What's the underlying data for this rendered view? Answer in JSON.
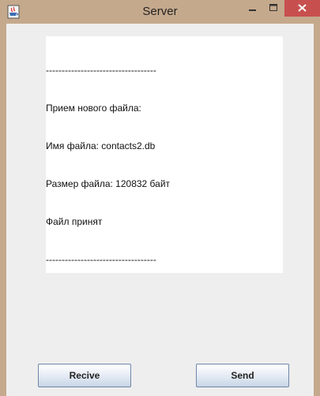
{
  "window": {
    "title": "Server",
    "controls": {
      "minimize": "minimize-icon",
      "maximize": "maximize-icon",
      "close": "close-icon"
    },
    "app_icon": "java-cup-icon"
  },
  "log": {
    "lines": [
      "-----------------------------------",
      "Прием нового файла:",
      "Имя файла: contacts2.db",
      "Размер файла: 120832 байт",
      "Файл принят",
      "-----------------------------------"
    ]
  },
  "buttons": {
    "recive_label": "Recive",
    "send_label": "Send"
  },
  "colors": {
    "frame": "#c5a98c",
    "close_button": "#c7504f",
    "client_background": "#eeeeee",
    "text_area_background": "#ffffff"
  }
}
